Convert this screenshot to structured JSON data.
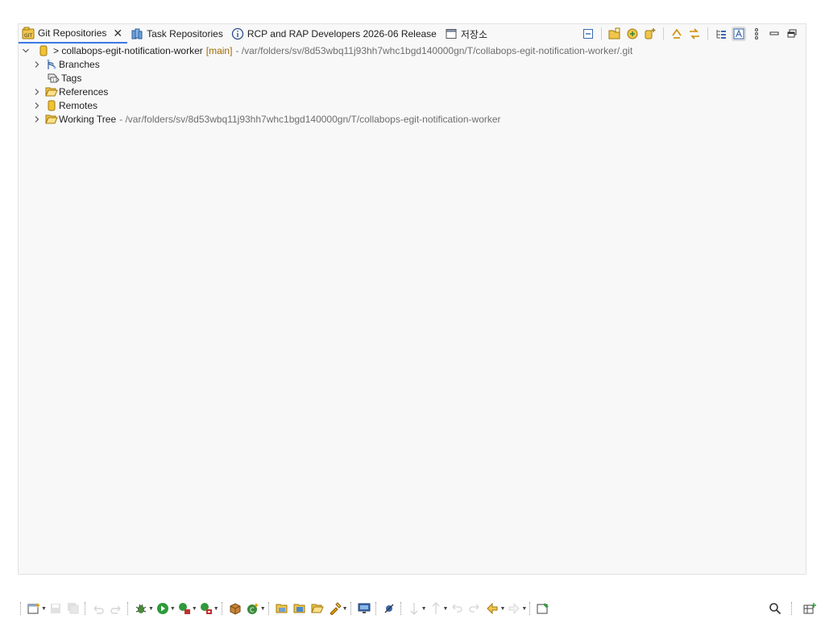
{
  "tabs": [
    {
      "label": "Git Repositories",
      "icon": "git-repositories-icon",
      "active": true
    },
    {
      "label": "Task Repositories",
      "icon": "task-repositories-icon"
    },
    {
      "label": "RCP and RAP Developers 2026-06 Release",
      "icon": "info-icon"
    },
    {
      "label": "저장소",
      "icon": "window-icon"
    }
  ],
  "tree": {
    "repo": {
      "name": "> collabops-egit-notification-worker",
      "branch": "[main]",
      "path": "- /var/folders/sv/8d53wbq11j93hh7whc1bgd140000gn/T/collabops-egit-notification-worker/.git"
    },
    "children": {
      "branches": "Branches",
      "tags": "Tags",
      "references": "References",
      "remotes": "Remotes",
      "working_tree": "Working Tree",
      "working_tree_path": "- /var/folders/sv/8d53wbq11j93hh7whc1bgd140000gn/T/collabops-egit-notification-worker"
    }
  },
  "colors": {
    "active_tab_underline": "#3b78e7",
    "branch_label": "#a06b00",
    "path_text": "#6e6e6e",
    "repo_icon": "#f2c230"
  }
}
